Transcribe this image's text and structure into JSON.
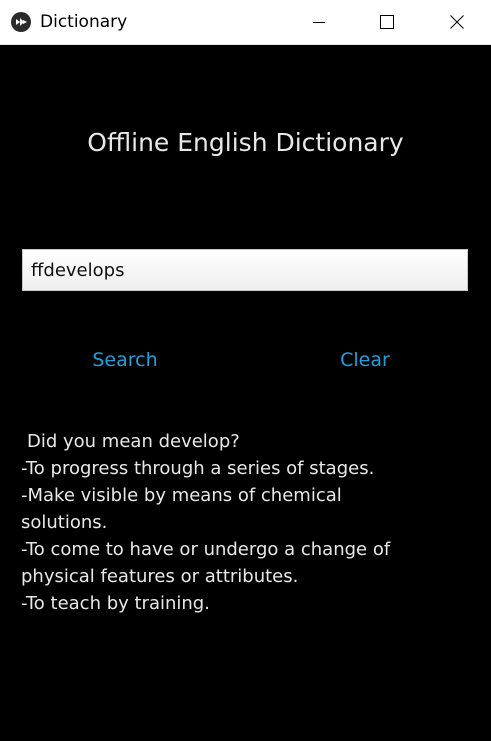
{
  "window": {
    "title": "Dictionary",
    "icon": "kivy-logo-icon",
    "controls": [
      "minimize-icon",
      "maximize-icon",
      "close-icon"
    ]
  },
  "app": {
    "heading": "Offline English Dictionary",
    "search_input_value": "ffdevelops",
    "search_button_label": "Search",
    "clear_button_label": "Clear",
    "result_lines": [
      "Did you mean develop?",
      "-To progress through a series of stages.",
      "-Make visible by means of chemical",
      "solutions.",
      "-To come to have or undergo a change of",
      "physical features or attributes.",
      "-To teach by training."
    ]
  },
  "colors": {
    "background": "#000000",
    "accent": "#1fa0dc",
    "text": "#e8e8e8"
  }
}
